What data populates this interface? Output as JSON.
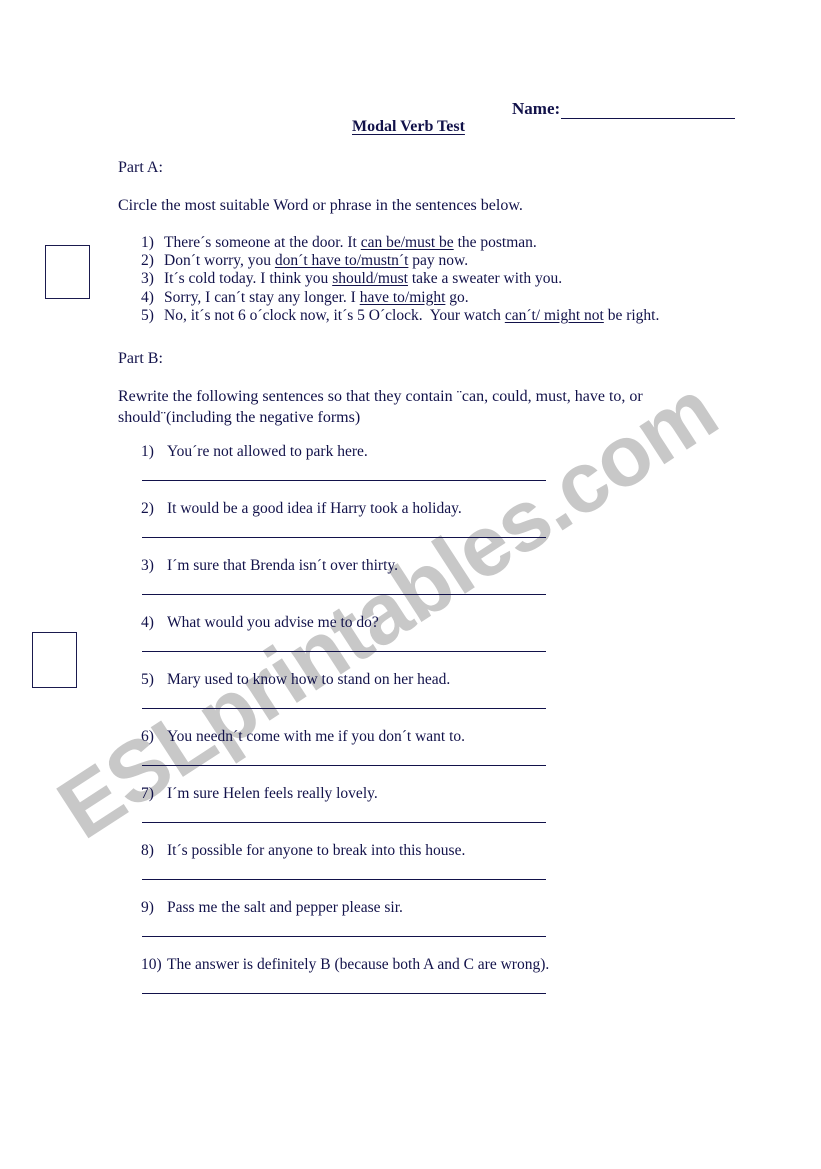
{
  "document": {
    "title": "Modal Verb Test",
    "name_field": {
      "label": "Name:",
      "value": ""
    }
  },
  "part_a": {
    "label": "Part A:",
    "instruction": "Circle the most suitable Word or phrase in the sentences below.",
    "items": [
      {
        "number": "1)",
        "before": "There´s someone at the door. It ",
        "choice": "can be/must be",
        "after": " the postman."
      },
      {
        "number": "2)",
        "before": "Don´t worry, you ",
        "choice": "don´t have to/mustn´t",
        "after": " pay now."
      },
      {
        "number": "3)",
        "before": "It´s cold today. I think you ",
        "choice": "should/must",
        "after": " take a sweater with you."
      },
      {
        "number": "4)",
        "before": "Sorry, I can´t stay any longer. I ",
        "choice": "have to/might",
        "after": " go."
      },
      {
        "number": "5)",
        "before": "No, it´s not 6 o´clock now, it´s 5 O´clock.  Your watch ",
        "choice": "can´t/ might not",
        "after": " be right."
      }
    ]
  },
  "part_b": {
    "label": "Part B:",
    "instruction": "Rewrite the following sentences so that they contain ¨can, could, must, have to, or should¨(including the negative forms)",
    "items": [
      {
        "number": "1)",
        "text": "You´re not allowed to park here.",
        "answer": ""
      },
      {
        "number": "2)",
        "text": "It would be a good idea if Harry took a holiday.",
        "answer": ""
      },
      {
        "number": "3)",
        "text": "I´m sure that Brenda isn´t over thirty.",
        "answer": ""
      },
      {
        "number": "4)",
        "text": "What would you advise me to do?",
        "answer": ""
      },
      {
        "number": "5)",
        "text": "Mary used to know how to stand on her head.",
        "answer": ""
      },
      {
        "number": "6)",
        "text": "You needn´t come with me if you don´t want to.",
        "answer": ""
      },
      {
        "number": "7)",
        "text": "I´m sure Helen feels really lovely.",
        "answer": ""
      },
      {
        "number": "8)",
        "text": "It´s possible for anyone to break into this house.",
        "answer": ""
      },
      {
        "number": "9)",
        "text": "Pass me the salt and pepper please sir.",
        "answer": ""
      },
      {
        "number": "10)",
        "text": "The answer is definitely B (because both A and C are wrong).",
        "answer": ""
      }
    ]
  },
  "watermark": {
    "text": "ESLprintables.com",
    "color": "#c8c8c8"
  },
  "colors": {
    "text": "#12124a",
    "rule": "#12124a",
    "box_border": "#1a1a4e",
    "background": "#ffffff"
  }
}
